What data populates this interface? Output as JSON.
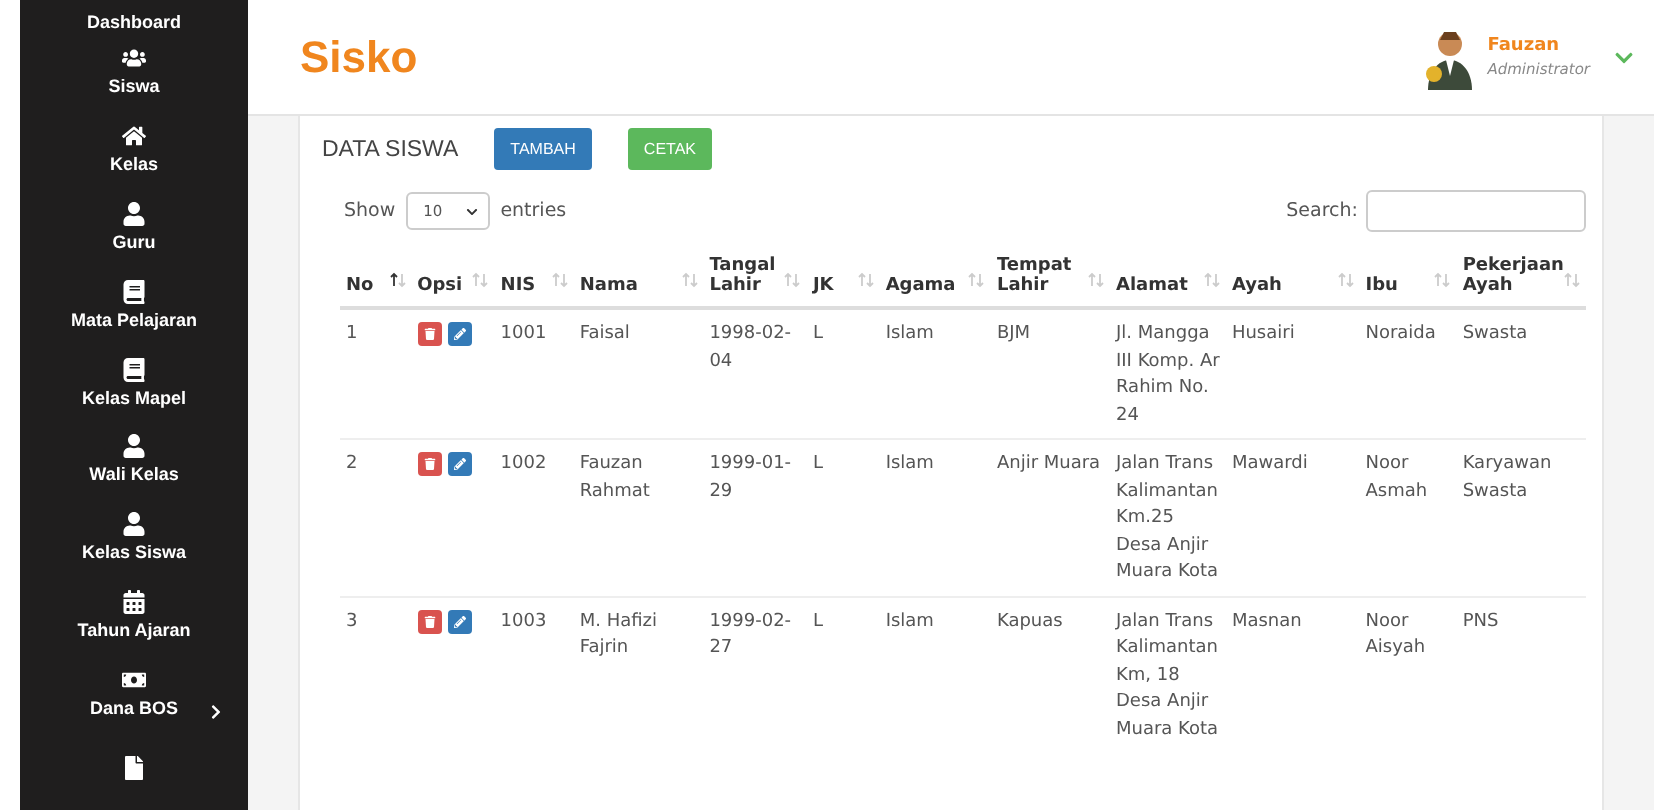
{
  "sidebar": {
    "items": [
      {
        "label": "Dashboard",
        "has_submenu": false
      },
      {
        "label": "Siswa",
        "has_submenu": false
      },
      {
        "label": "Kelas",
        "has_submenu": false
      },
      {
        "label": "Guru",
        "has_submenu": false
      },
      {
        "label": "Mata Pelajaran",
        "has_submenu": false
      },
      {
        "label": "Kelas Mapel",
        "has_submenu": false
      },
      {
        "label": "Wali Kelas",
        "has_submenu": false
      },
      {
        "label": "Kelas Siswa",
        "has_submenu": false
      },
      {
        "label": "Tahun Ajaran",
        "has_submenu": false
      },
      {
        "label": "Dana BOS",
        "has_submenu": true
      }
    ]
  },
  "header": {
    "brand": "Sisko",
    "user": {
      "name": "Fauzan",
      "role": "Administrator"
    }
  },
  "panel": {
    "title": "DATA SISWA",
    "buttons": [
      {
        "label": "TAMBAH",
        "kind": "primary"
      },
      {
        "label": "CETAK",
        "kind": "success"
      }
    ],
    "length": {
      "show": "Show",
      "value": "10",
      "entries": "entries"
    },
    "search": {
      "label": "Search:"
    }
  },
  "table": {
    "columns": [
      {
        "label": "No",
        "sorted": true
      },
      {
        "label": "Opsi",
        "sorted": false
      },
      {
        "label": "NIS",
        "sorted": false
      },
      {
        "label": "Nama",
        "sorted": false
      },
      {
        "label": "Tangal Lahir",
        "sorted": false
      },
      {
        "label": "JK",
        "sorted": false
      },
      {
        "label": "Agama",
        "sorted": false
      },
      {
        "label": "Tempat Lahir",
        "sorted": false
      },
      {
        "label": "Alamat",
        "sorted": false
      },
      {
        "label": "Ayah",
        "sorted": false
      },
      {
        "label": "Ibu",
        "sorted": false
      },
      {
        "label": "Pekerjaan Ayah",
        "sorted": false
      }
    ],
    "rows": [
      {
        "no": "1",
        "nis": "1001",
        "nama": "Faisal",
        "lahir": "1998-02-04",
        "jk": "L",
        "agama": "Islam",
        "tempat": "BJM",
        "alamat": "Jl. Mangga III Komp. Ar Rahim No. 24",
        "ayah": "Husairi",
        "ibu": "Noraida",
        "pekerjaan": "Swasta"
      },
      {
        "no": "2",
        "nis": "1002",
        "nama": "Fauzan Rahmat",
        "lahir": "1999-01-29",
        "jk": "L",
        "agama": "Islam",
        "tempat": "Anjir Muara",
        "alamat": "Jalan Trans Kalimantan Km.25 Desa Anjir Muara Kota",
        "ayah": "Mawardi",
        "ibu": "Noor Asmah",
        "pekerjaan": "Karyawan Swasta"
      },
      {
        "no": "3",
        "nis": "1003",
        "nama": "M. Hafizi Fajrin",
        "lahir": "1999-02-27",
        "jk": "L",
        "agama": "Islam",
        "tempat": "Kapuas",
        "alamat": "Jalan Trans Kalimantan Km, 18 Desa Anjir Muara Kota",
        "ayah": "Masnan",
        "ibu": "Noor Aisyah",
        "pekerjaan": "PNS"
      }
    ]
  }
}
